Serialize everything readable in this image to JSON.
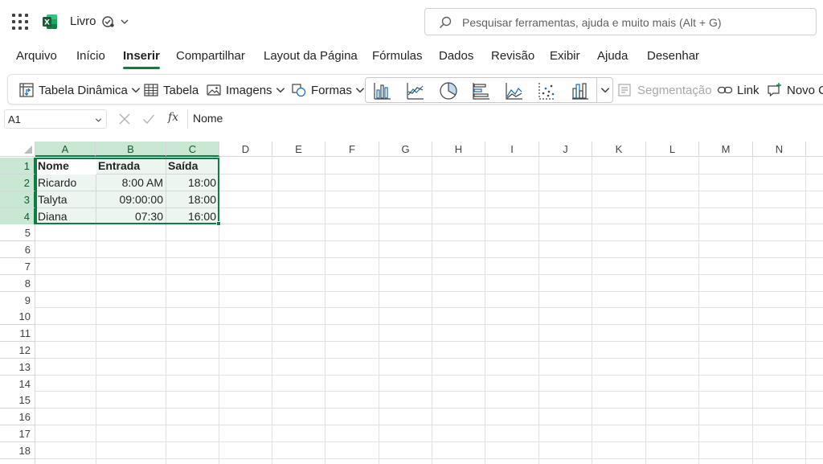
{
  "app": {
    "title": "Livro",
    "search_placeholder": "Pesquisar ferramentas, ajuda e muito mais (Alt + G)",
    "accent_color": "#107c41"
  },
  "menu": {
    "tabs": [
      "Arquivo",
      "Início",
      "Inserir",
      "Compartilhar",
      "Layout da Página",
      "Fórmulas",
      "Dados",
      "Revisão",
      "Exibir",
      "Ajuda",
      "Desenhar"
    ],
    "active": "Inserir"
  },
  "ribbon": {
    "pivot_table": "Tabela Dinâmica",
    "table": "Tabela",
    "images": "Imagens",
    "shapes": "Formas",
    "charts": [
      "column-chart-icon",
      "line-chart-icon",
      "pie-chart-icon",
      "bar-chart-icon",
      "area-chart-icon",
      "scatter-chart-icon",
      "histogram-chart-icon"
    ],
    "slicer": "Segmentação",
    "link": "Link",
    "new_comment": "Novo C"
  },
  "formula_bar": {
    "name_box": "A1",
    "fx": "fx",
    "value": "Nome"
  },
  "sheet": {
    "columns": [
      "A",
      "B",
      "C",
      "D",
      "E",
      "F",
      "G",
      "H",
      "I",
      "J",
      "K",
      "L",
      "M",
      "N"
    ],
    "rows": [
      "1",
      "2",
      "3",
      "4",
      "5",
      "6",
      "7",
      "8",
      "9",
      "10",
      "11",
      "12",
      "13",
      "14",
      "15",
      "16",
      "17",
      "18"
    ],
    "selected_range": "A1:C4",
    "data": [
      [
        "Nome",
        "Entrada",
        "Saída"
      ],
      [
        "Ricardo",
        "8:00 AM",
        "18:00"
      ],
      [
        "Talyta",
        "09:00:00",
        "18:00"
      ],
      [
        "Diana",
        "07:30",
        "16:00"
      ]
    ]
  }
}
